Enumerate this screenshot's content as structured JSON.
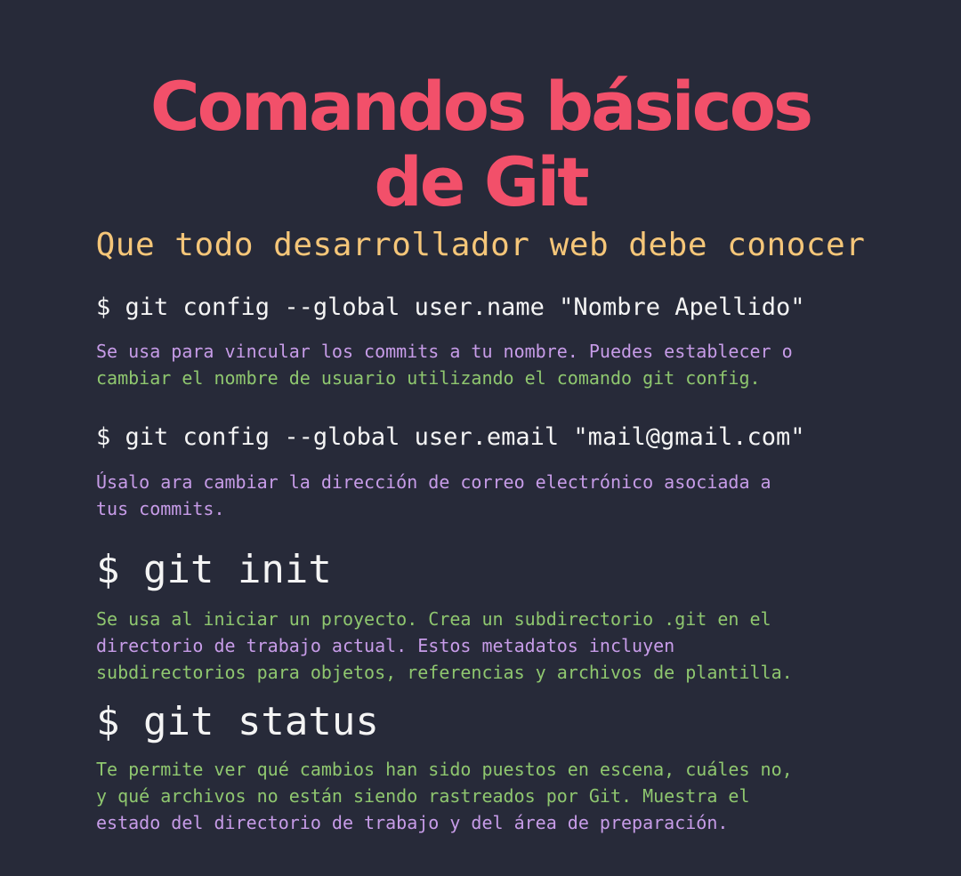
{
  "header": {
    "title_line1": "Comandos básicos",
    "title_line2": "de Git",
    "subtitle": "Que todo desarrollador web debe conocer"
  },
  "commands": [
    {
      "command": "$ git config --global user.name \"Nombre Apellido\"",
      "description_lines": [
        "Se usa para vincular los commits a tu nombre. Puedes establecer o",
        "cambiar el nombre de usuario utilizando el comando git config."
      ]
    },
    {
      "command": "$ git config --global user.email \"mail@gmail.com\"",
      "description_lines": [
        "Úsalo ara cambiar la dirección de correo electrónico asociada a",
        "tus commits."
      ]
    },
    {
      "command": "$ git init",
      "description_lines": [
        "Se usa al iniciar un proyecto. Crea un subdirectorio .git en el",
        "directorio de trabajo actual. Estos metadatos incluyen",
        "subdirectorios para objetos, referencias y archivos de plantilla."
      ]
    },
    {
      "command": "$ git status",
      "description_lines": [
        "Te permite ver qué cambios han sido puestos en escena, cuáles no,",
        "y qué archivos no están siendo rastreados por Git. Muestra el",
        "estado del directorio de trabajo y del área de preparación."
      ]
    }
  ],
  "colors": {
    "background": "#272a39",
    "title": "#f2506a",
    "subtitle": "#f5c679",
    "command": "#f4f4f4",
    "description_purple": "#c79ce8",
    "description_green": "#8fc76f"
  }
}
